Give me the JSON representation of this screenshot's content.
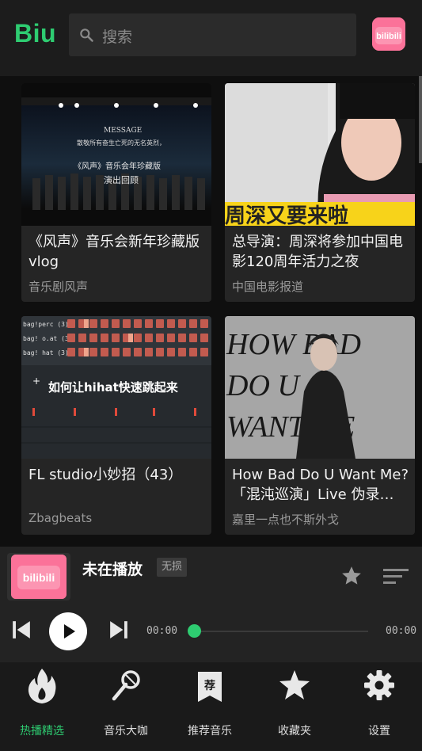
{
  "header": {
    "logo": "Biu",
    "search_placeholder": "搜索",
    "avatar_text": "bilibili"
  },
  "cards": [
    {
      "title": "《风声》音乐会新年珍藏版vlog",
      "author": "音乐剧风声",
      "thumb_lines": [
        "MESSAGE",
        "散敬所有奋生亡死的无名英烈，",
        "《风声》音乐会年珍藏版",
        "演出回顾"
      ]
    },
    {
      "title": "总导演：周深将参加中国电影120周年活力之夜",
      "author": "中国电影报道",
      "thumb_caption": "周深又要来啦"
    },
    {
      "title": "FL studio小妙招（43）",
      "author": "Zbagbeats",
      "thumb_rows": [
        "bag!perc (3)",
        "bag! o.at (3)",
        "bag! hat (3)"
      ],
      "thumb_caption": "如何让hihat快速跳起来"
    },
    {
      "title": "How Bad Do U Want Me? 「混沌巡演」Live 伪录…",
      "author": "嘉里一点也不斯外戈",
      "thumb_lines": [
        "HOW BAD",
        "DO U",
        "WANT ME"
      ]
    }
  ],
  "player": {
    "now_playing": "未在播放",
    "quality_badge": "无损",
    "cover_text": "bilibili",
    "time_current": "00:00",
    "time_total": "00:00",
    "progress": 0
  },
  "nav": [
    {
      "label": "热播精选",
      "icon": "flame-icon",
      "active": true
    },
    {
      "label": "音乐大咖",
      "icon": "microphone-icon",
      "active": false
    },
    {
      "label": "推荐音乐",
      "icon": "recommend-icon",
      "icon_text": "荐",
      "active": false
    },
    {
      "label": "收藏夹",
      "icon": "star-icon",
      "active": false
    },
    {
      "label": "设置",
      "icon": "gear-icon",
      "active": false
    }
  ],
  "colors": {
    "accent": "#2ecc71",
    "bilibili_pink": "#fb7299",
    "background": "#0f0f0f",
    "card": "#252525"
  }
}
